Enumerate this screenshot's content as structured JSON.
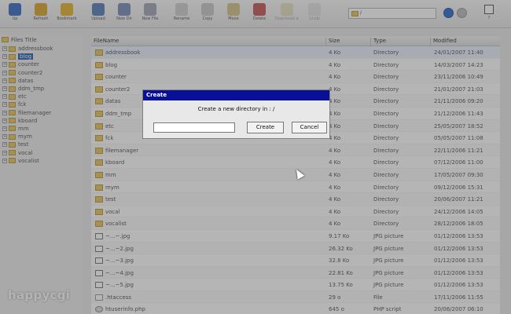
{
  "toolbar": {
    "buttons": [
      {
        "label": "Up",
        "icon": "up-arrow-icon",
        "color": "#3b6fc4"
      },
      {
        "label": "Refresh",
        "icon": "refresh-icon",
        "color": "#d9a630"
      },
      {
        "label": "Bookmark",
        "icon": "star-icon",
        "color": "#e6b430"
      },
      {
        "label": "Upload",
        "icon": "upload-icon",
        "color": "#5b80b8"
      },
      {
        "label": "New Dir",
        "icon": "new-folder-icon",
        "color": "#7b8fb6"
      },
      {
        "label": "New File",
        "icon": "new-file-icon",
        "color": "#a0a6b4"
      },
      {
        "label": "Rename",
        "icon": "rename-icon",
        "color": "#cfcfcf"
      },
      {
        "label": "Copy",
        "icon": "copy-icon",
        "color": "#c9c9c9"
      },
      {
        "label": "Move",
        "icon": "move-icon",
        "color": "#d4c488"
      },
      {
        "label": "Delete",
        "icon": "delete-icon",
        "color": "#c75a5a"
      },
      {
        "label": "Download as Zip",
        "icon": "zip-icon",
        "color": "#d6c98a"
      },
      {
        "label": "Unzip",
        "icon": "unzip-icon",
        "color": "#cfcfcf"
      }
    ],
    "path_value": "/",
    "square_label": "?"
  },
  "tree": {
    "root_label": "Files Title",
    "items": [
      {
        "label": "addressbook"
      },
      {
        "label": "blog"
      },
      {
        "label": "counter"
      },
      {
        "label": "counter2"
      },
      {
        "label": "datas"
      },
      {
        "label": "ddm_tmp"
      },
      {
        "label": "etc"
      },
      {
        "label": "fck"
      },
      {
        "label": "filemanager"
      },
      {
        "label": "kboard"
      },
      {
        "label": "mm"
      },
      {
        "label": "mym"
      },
      {
        "label": "test"
      },
      {
        "label": "vocal"
      },
      {
        "label": "vocalist"
      }
    ],
    "selected_index": 1
  },
  "logo": "happycgi",
  "table": {
    "headers": {
      "name": "FileName",
      "size": "Size",
      "type": "Type",
      "modified": "Modified"
    },
    "rows": [
      {
        "name": "addressbook",
        "size": "4 Ko",
        "type": "Directory",
        "modified": "24/01/2007 11:40",
        "kind": "dir"
      },
      {
        "name": "blog",
        "size": "4 Ko",
        "type": "Directory",
        "modified": "14/03/2007 14:23",
        "kind": "dir"
      },
      {
        "name": "counter",
        "size": "4 Ko",
        "type": "Directory",
        "modified": "23/11/2006 10:49",
        "kind": "dir"
      },
      {
        "name": "counter2",
        "size": "4 Ko",
        "type": "Directory",
        "modified": "21/01/2007 21:03",
        "kind": "dir"
      },
      {
        "name": "datas",
        "size": "4 Ko",
        "type": "Directory",
        "modified": "21/11/2006 09:20",
        "kind": "dir"
      },
      {
        "name": "ddm_tmp",
        "size": "4 Ko",
        "type": "Directory",
        "modified": "21/12/2006 11:43",
        "kind": "dir"
      },
      {
        "name": "etc",
        "size": "4 Ko",
        "type": "Directory",
        "modified": "25/05/2007 18:52",
        "kind": "dir"
      },
      {
        "name": "fck",
        "size": "4 Ko",
        "type": "Directory",
        "modified": "05/05/2007 11:08",
        "kind": "dir"
      },
      {
        "name": "filemanager",
        "size": "4 Ko",
        "type": "Directory",
        "modified": "22/11/2006 11:21",
        "kind": "dir"
      },
      {
        "name": "kboard",
        "size": "4 Ko",
        "type": "Directory",
        "modified": "07/12/2006 11:00",
        "kind": "dir"
      },
      {
        "name": "mm",
        "size": "4 Ko",
        "type": "Directory",
        "modified": "17/05/2007 09:30",
        "kind": "dir"
      },
      {
        "name": "mym",
        "size": "4 Ko",
        "type": "Directory",
        "modified": "09/12/2006 15:31",
        "kind": "dir"
      },
      {
        "name": "test",
        "size": "4 Ko",
        "type": "Directory",
        "modified": "20/06/2007 11:21",
        "kind": "dir"
      },
      {
        "name": "vocal",
        "size": "4 Ko",
        "type": "Directory",
        "modified": "24/12/2006 14:05",
        "kind": "dir"
      },
      {
        "name": "vocalist",
        "size": "4 Ko",
        "type": "Directory",
        "modified": "28/12/2006 18:05",
        "kind": "dir"
      },
      {
        "name": "~...~.jpg",
        "size": "9.17 Ko",
        "type": "JPG picture",
        "modified": "01/12/2006 13:53",
        "kind": "jpg"
      },
      {
        "name": "~...~2.jpg",
        "size": "26.32 Ko",
        "type": "JPG picture",
        "modified": "01/12/2006 13:53",
        "kind": "jpg"
      },
      {
        "name": "~...~3.jpg",
        "size": "32.8 Ko",
        "type": "JPG picture",
        "modified": "01/12/2006 13:53",
        "kind": "jpg"
      },
      {
        "name": "~...~4.jpg",
        "size": "22.81 Ko",
        "type": "JPG picture",
        "modified": "01/12/2006 13:53",
        "kind": "jpg"
      },
      {
        "name": "~...~5.jpg",
        "size": "13.75 Ko",
        "type": "JPG picture",
        "modified": "01/12/2006 13:53",
        "kind": "jpg"
      },
      {
        "name": ".htaccess",
        "size": "29 o",
        "type": "File",
        "modified": "17/11/2006 11:55",
        "kind": "file"
      },
      {
        "name": "htuserinfo.php",
        "size": "645 o",
        "type": "PHP script",
        "modified": "20/06/2007 06:10",
        "kind": "php"
      }
    ]
  },
  "dialog": {
    "title": "Create",
    "message": "Create a new directory in : /",
    "input_value": "",
    "create_label": "Create",
    "cancel_label": "Cancel"
  }
}
